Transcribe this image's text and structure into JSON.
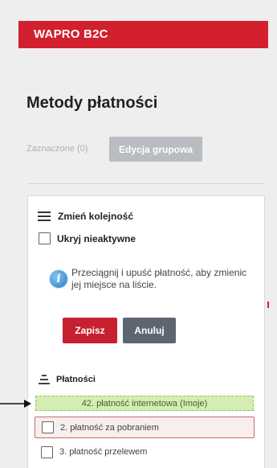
{
  "app": {
    "name": "WAPRO B2C"
  },
  "page": {
    "title": "Metody płatności"
  },
  "toolbar": {
    "selected_label": "Zaznaczone (0)",
    "group_edit_label": "Edycja grupowa"
  },
  "panel": {
    "reorder_label": "Zmień kolejność",
    "hide_inactive_label": "Ukryj nieaktywne",
    "info_text": "Przeciągnij i upuść płatność, aby zmienic jej miejsce na liście.",
    "save_label": "Zapisz",
    "cancel_label": "Anuluj",
    "payments_heading": "Płatności",
    "dragging_item": "42. płatność internetowa (Imoje)",
    "items": [
      {
        "label": "2. płatność za pobraniem",
        "highlighted": true
      },
      {
        "label": "3. płatność przelewem",
        "highlighted": false
      }
    ]
  },
  "colors": {
    "brand_red": "#d3202e",
    "drop_zone": "#d4edb2",
    "cancel_gray": "#5d6670"
  },
  "icons": {
    "reorder": "list-icon",
    "info": "info-icon",
    "sort": "sort-icon",
    "pointer": "arrow-right-icon"
  }
}
